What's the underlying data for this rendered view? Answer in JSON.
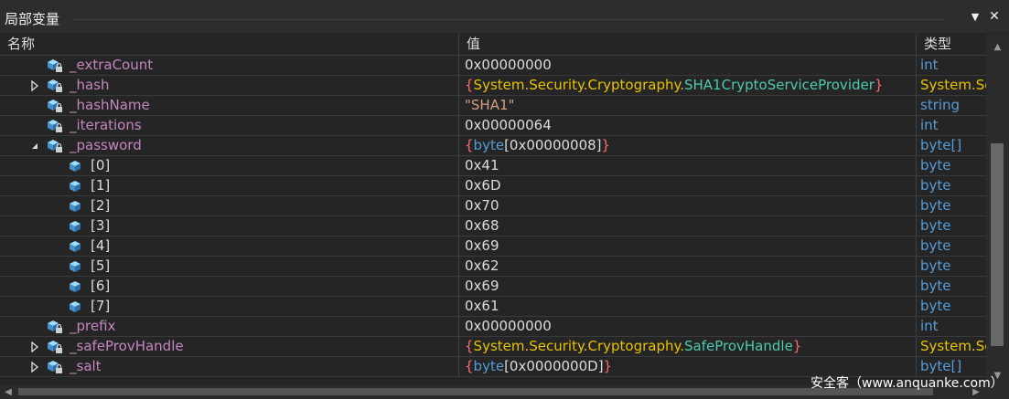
{
  "window": {
    "title": "局部变量",
    "dropdown_glyph": "▼",
    "close_glyph": "✕"
  },
  "columns": {
    "name": "名称",
    "value": "值",
    "type": "类型"
  },
  "rows": [
    {
      "name": "_extraCount",
      "value": "0x00000000",
      "type": "int"
    },
    {
      "name": "_hash",
      "value_parts": [
        "{",
        "System.Security.Cryptography.",
        "SHA1CryptoServiceProvider",
        "}"
      ],
      "type": "System.Se"
    },
    {
      "name": "_hashName",
      "value": "\"SHA1\"",
      "type": "string"
    },
    {
      "name": "_iterations",
      "value": "0x00000064",
      "type": "int"
    },
    {
      "name": "_password",
      "value_parts": [
        "{",
        "byte",
        "[0x00000008]",
        "}"
      ],
      "type": "byte[]"
    },
    {
      "name": "[0]",
      "value": "0x41",
      "type": "byte"
    },
    {
      "name": "[1]",
      "value": "0x6D",
      "type": "byte"
    },
    {
      "name": "[2]",
      "value": "0x70",
      "type": "byte"
    },
    {
      "name": "[3]",
      "value": "0x68",
      "type": "byte"
    },
    {
      "name": "[4]",
      "value": "0x69",
      "type": "byte"
    },
    {
      "name": "[5]",
      "value": "0x62",
      "type": "byte"
    },
    {
      "name": "[6]",
      "value": "0x69",
      "type": "byte"
    },
    {
      "name": "[7]",
      "value": "0x61",
      "type": "byte"
    },
    {
      "name": "_prefix",
      "value": "0x00000000",
      "type": "int"
    },
    {
      "name": "_safeProvHandle",
      "value_parts": [
        "{",
        "System.Security.Cryptography.",
        "SafeProvHandle",
        "}"
      ],
      "type": "System.Se"
    },
    {
      "name": "_salt",
      "value_parts": [
        "{",
        "byte",
        "[0x0000000D]",
        "}"
      ],
      "type": "byte[]"
    }
  ],
  "watermark": "安全客（www.anquanke.com）",
  "colors": {
    "background": "#252526",
    "field_name": "#c586c0",
    "type_keyword": "#569cd6",
    "class_name": "#4ec9b0",
    "namespace": "#e8c300",
    "brace": "#ff6b6b",
    "string": "#d69d85"
  }
}
